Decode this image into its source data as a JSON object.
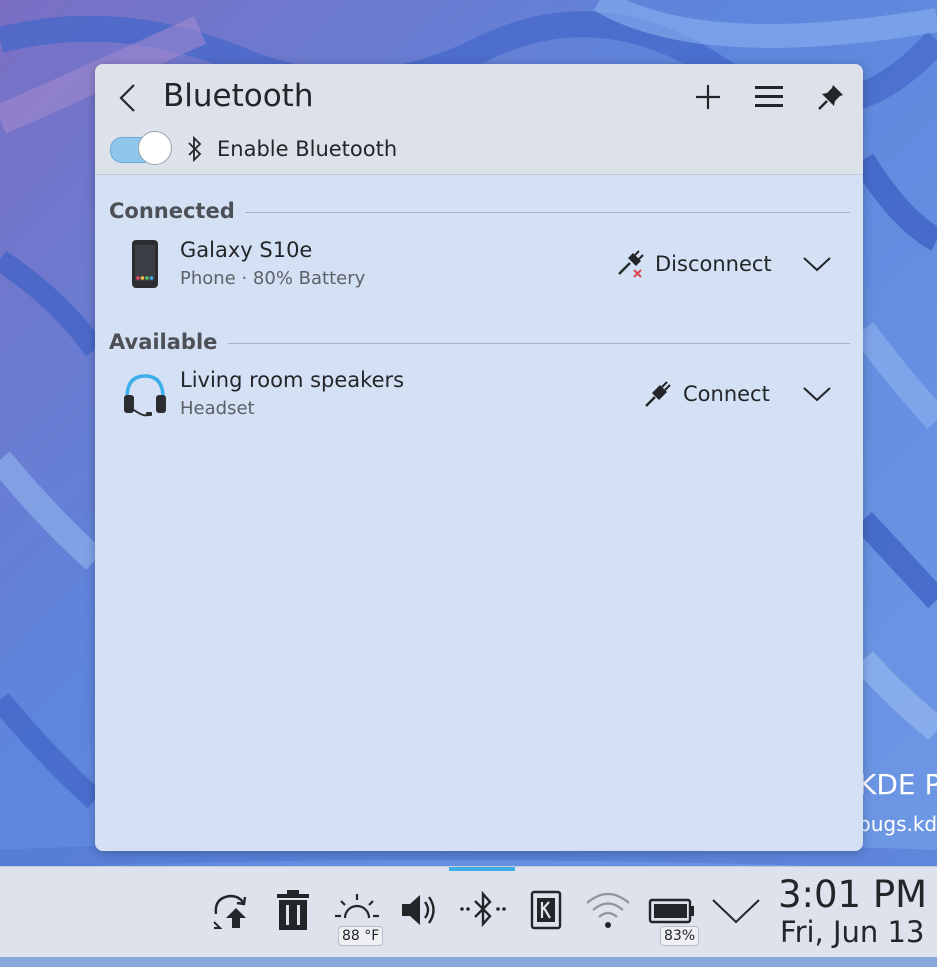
{
  "desktop": {
    "text_line1": "KDE P",
    "text_line2": "bugs.kd"
  },
  "popup": {
    "title": "Bluetooth",
    "enable_label": "Enable Bluetooth",
    "bluetooth_enabled": true,
    "sections": {
      "connected": "Connected",
      "available": "Available"
    },
    "devices": [
      {
        "name": "Galaxy S10e",
        "subtitle": "Phone · 80% Battery",
        "icon": "phone-icon",
        "action": "Disconnect",
        "action_icon": "disconnect-plug-icon"
      },
      {
        "name": "Living room speakers",
        "subtitle": "Headset",
        "icon": "headset-icon",
        "action": "Connect",
        "action_icon": "connect-plug-icon"
      }
    ]
  },
  "taskbar": {
    "weather_temp": "88 °F",
    "battery_percent": "83%",
    "clock_time": "3:01 PM",
    "clock_date": "Fri, Jun 13",
    "tray_icons": [
      "updates-icon",
      "trash-icon",
      "weather-sun-icon",
      "volume-icon",
      "bluetooth-icon",
      "kde-connect-icon",
      "wifi-icon",
      "battery-icon",
      "expand-tray-icon"
    ]
  },
  "colors": {
    "accent": "#3daee9",
    "popup_bg": "#d4e1f4",
    "header_bg": "#dde1e9",
    "text": "#232629"
  }
}
